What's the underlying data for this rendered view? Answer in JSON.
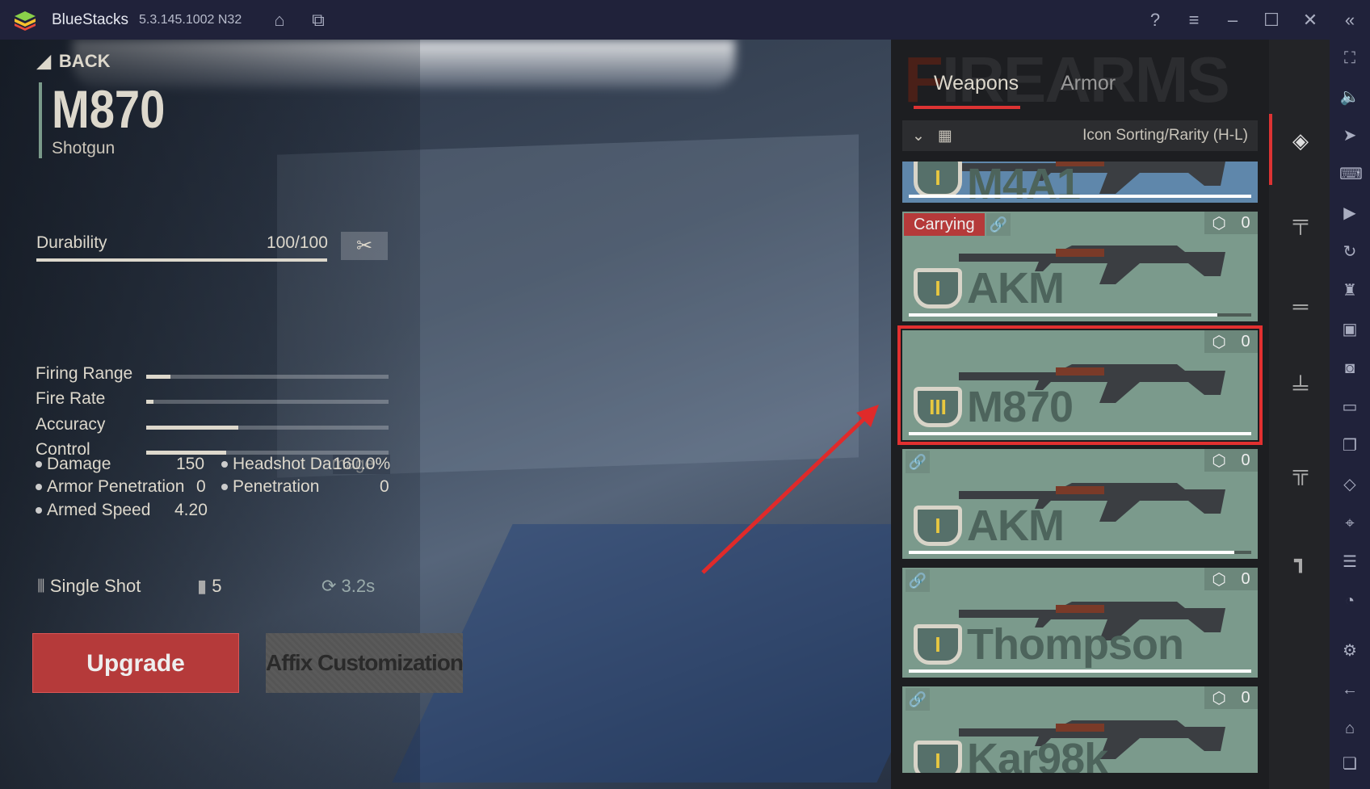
{
  "titlebar": {
    "app": "BlueStacks",
    "version": "5.3.145.1002 N32"
  },
  "weapon": {
    "back": "BACK",
    "name": "M870",
    "type": "Shotgun",
    "durability_label": "Durability",
    "durability_value": "100/100",
    "durability_pct": 100,
    "bars": [
      {
        "label": "Firing Range",
        "pct": 10
      },
      {
        "label": "Fire Rate",
        "pct": 3
      },
      {
        "label": "Accuracy",
        "pct": 38
      },
      {
        "label": "Control",
        "pct": 33
      }
    ],
    "stats": {
      "damage_label": "Damage",
      "damage": "150",
      "headshot_label": "Headshot Damage",
      "headshot": "160.0%",
      "armor_pen_label": "Armor Penetration",
      "armor_pen": "0",
      "pen_label": "Penetration",
      "pen": "0",
      "speed_label": "Armed Speed",
      "speed": "4.20"
    },
    "fire_mode": "Single Shot",
    "magazine": "5",
    "reload": "3.2s",
    "upgrade": "Upgrade",
    "affix": "Affix Customization"
  },
  "panel": {
    "bg_title": "FIREARMS",
    "tabs": [
      "Weapons",
      "Armor"
    ],
    "sort_label": "Icon Sorting/Rarity (H-L)",
    "cards": [
      {
        "name": "M4A1",
        "rarity": "I",
        "durability": 100,
        "color": "#5f87ab"
      },
      {
        "name": "AKM",
        "rarity": "I",
        "durability": 90,
        "count": "0",
        "carrying": "Carrying",
        "linked": true,
        "color": "#7b9a8c"
      },
      {
        "name": "M870",
        "rarity": "III",
        "durability": 100,
        "count": "0",
        "selected": true,
        "color": "#7b9a8c"
      },
      {
        "name": "AKM",
        "rarity": "I",
        "durability": 95,
        "count": "0",
        "linked": true,
        "color": "#7b9a8c"
      },
      {
        "name": "Thompson",
        "rarity": "I",
        "durability": 100,
        "count": "0",
        "linked": true,
        "color": "#7b9a8c"
      },
      {
        "name": "Kar98k",
        "rarity": "I",
        "durability": 100,
        "count": "0",
        "linked": true,
        "color": "#7b9a8c"
      }
    ]
  },
  "colors": {
    "accent": "#d33333",
    "card": "#7b9a8c",
    "chrome": "#20223a"
  }
}
